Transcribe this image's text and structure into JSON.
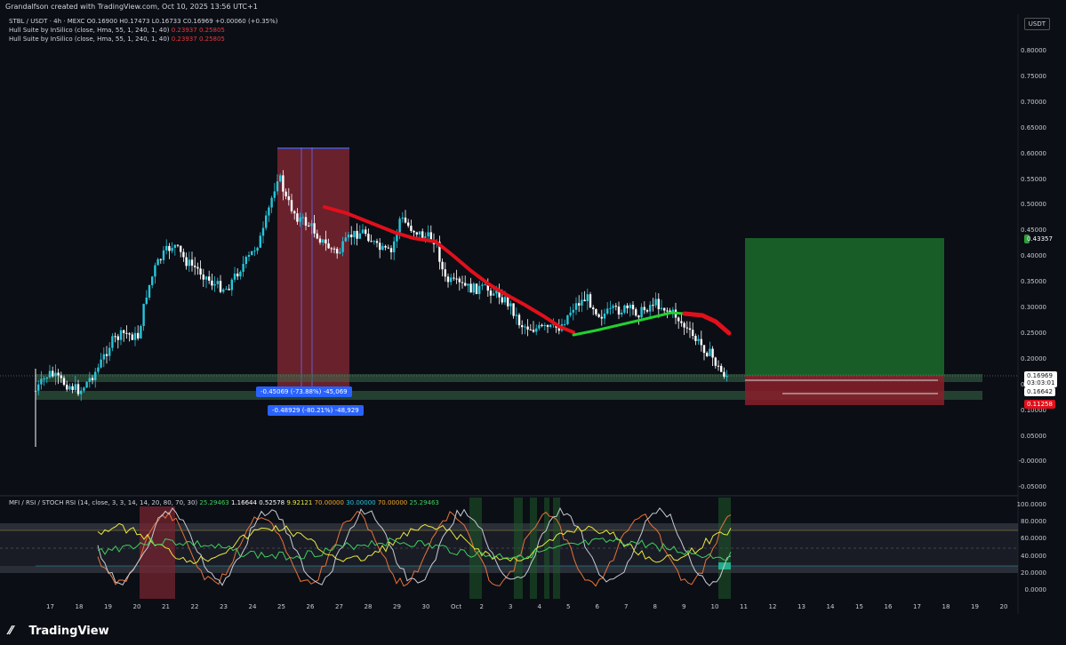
{
  "header": {
    "title": "Grandalfson created with TradingView.com, Oct 10, 2025 13:56 UTC+1"
  },
  "legend": {
    "symbol_line": "STBL / USDT · 4h · MEXC",
    "ohlc_o": "O0.16900",
    "ohlc_h": "H0.17473",
    "ohlc_l": "L0.16733",
    "ohlc_c": "C0.16969",
    "ohlc_change": "+0.00060 (+0.35%)",
    "hull1_name": "Hull Suite by InSilico (close, Hma, 55, 1, 240, 1, 40)",
    "hull1_v1": "0.23937",
    "hull1_v2": "0.25805",
    "hull2_name": "Hull Suite by InSilico (close, Hma, 55, 1, 240, 1, 40)",
    "hull2_v1": "0.23937",
    "hull2_v2": "0.25805"
  },
  "currency_button": "USDT",
  "price_axis": [
    "0.80000",
    "0.75000",
    "0.70000",
    "0.65000",
    "0.60000",
    "0.55000",
    "0.50000",
    "0.45000",
    "0.40000",
    "0.35000",
    "0.30000",
    "0.25000",
    "0.20000",
    "0.15000",
    "0.10000",
    "0.05000",
    "-0.00000",
    "-0.05000"
  ],
  "price_badges": {
    "target": "0.43357",
    "current": "0.16969",
    "countdown": "03:03:01",
    "entry": "0.16642",
    "stop": "0.11258"
  },
  "measure_labels": {
    "m1": "-0.45069 (-73.88%) -45,069",
    "m2": "-0.48929 (-80.21%) -48,929"
  },
  "indicator_legend": {
    "name": "MFI / RSI / STOCH RSI (14, close, 3, 3, 14, 14, 20, 80, 70, 30)",
    "v1": "25.29463",
    "v2": "1.16644",
    "v3": "0.52578",
    "v4": "9.92121",
    "v5": "70.00000",
    "v6": "30.00000",
    "v7": "70.00000",
    "v8": "25.29463"
  },
  "indicator_axis": [
    "100.0000",
    "80.0000",
    "60.0000",
    "40.0000",
    "20.0000",
    "0.0000"
  ],
  "time_axis": [
    "17",
    "18",
    "19",
    "20",
    "21",
    "22",
    "23",
    "24",
    "25",
    "26",
    "27",
    "28",
    "29",
    "30",
    "Oct",
    "2",
    "3",
    "4",
    "5",
    "6",
    "7",
    "8",
    "9",
    "10",
    "11",
    "12",
    "13",
    "14",
    "15",
    "16",
    "17",
    "18",
    "19",
    "20"
  ],
  "brand": "TradingView",
  "colors": {
    "bg": "#0b0e15",
    "bull": "#26c6da",
    "bear": "#ffffff",
    "hull_red": "#e0101b",
    "hull_green": "#22d12f",
    "accent": "#2962ff"
  }
}
